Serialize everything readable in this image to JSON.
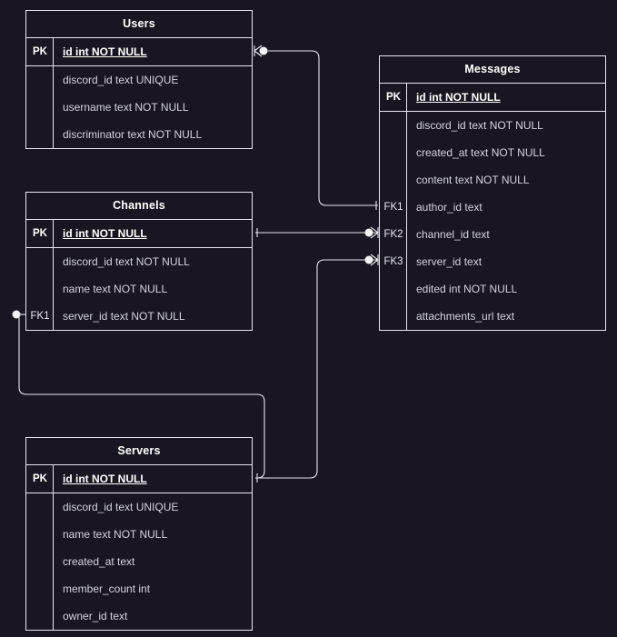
{
  "diagram": {
    "type": "entity-relationship-diagram",
    "notation": "crow's foot",
    "background_color": "#191622",
    "line_color": "#e8e8ef",
    "title_text_color": "#ffffff",
    "body_text_color": "#d4d4de"
  },
  "entities": [
    {
      "id": "users",
      "name": "Users",
      "attributes": [
        {
          "key": "PK",
          "name": "id int NOT NULL"
        },
        {
          "key": "",
          "name": "discord_id text UNIQUE"
        },
        {
          "key": "",
          "name": "username text NOT NULL"
        },
        {
          "key": "",
          "name": "discriminator text NOT NULL"
        }
      ]
    },
    {
      "id": "messages",
      "name": "Messages",
      "attributes": [
        {
          "key": "PK",
          "name": "id int NOT NULL"
        },
        {
          "key": "",
          "name": "discord_id text NOT NULL"
        },
        {
          "key": "",
          "name": "created_at text NOT NULL"
        },
        {
          "key": "",
          "name": "content text NOT NULL"
        },
        {
          "key": "FK1",
          "name": "author_id text"
        },
        {
          "key": "FK2",
          "name": "channel_id text"
        },
        {
          "key": "FK3",
          "name": "server_id text"
        },
        {
          "key": "",
          "name": "edited int NOT NULL"
        },
        {
          "key": "",
          "name": "attachments_url text"
        }
      ]
    },
    {
      "id": "channels",
      "name": "Channels",
      "attributes": [
        {
          "key": "PK",
          "name": "id int NOT NULL"
        },
        {
          "key": "",
          "name": "discord_id text NOT NULL"
        },
        {
          "key": "",
          "name": "name text NOT NULL"
        },
        {
          "key": "FK1",
          "name": "server_id text NOT NULL"
        }
      ]
    },
    {
      "id": "servers",
      "name": "Servers",
      "attributes": [
        {
          "key": "PK",
          "name": "id int NOT NULL"
        },
        {
          "key": "",
          "name": "discord_id text UNIQUE"
        },
        {
          "key": "",
          "name": "name text NOT NULL"
        },
        {
          "key": "",
          "name": "created_at text"
        },
        {
          "key": "",
          "name": "member_count int"
        },
        {
          "key": "",
          "name": "owner_id text"
        }
      ]
    }
  ],
  "relationships": [
    {
      "id": "users-messages",
      "from_entity": "Users",
      "from_attribute": "id int NOT NULL",
      "from_cardinality": "zero-or-many",
      "to_entity": "Messages",
      "to_attribute": "author_id text",
      "to_cardinality": "one"
    },
    {
      "id": "channels-messages",
      "from_entity": "Channels",
      "from_attribute": "id int NOT NULL",
      "from_cardinality": "one",
      "to_entity": "Messages",
      "to_attribute": "channel_id text",
      "to_cardinality": "zero-or-many"
    },
    {
      "id": "servers-messages",
      "from_entity": "Servers",
      "from_attribute": "id int NOT NULL",
      "from_cardinality": "one",
      "to_entity": "Messages",
      "to_attribute": "server_id text",
      "to_cardinality": "zero-or-many"
    },
    {
      "id": "servers-channels",
      "from_entity": "Servers",
      "from_attribute": "id int NOT NULL",
      "from_cardinality": "one",
      "to_entity": "Channels",
      "to_attribute": "server_id text NOT NULL",
      "to_cardinality": "zero-or-many"
    }
  ]
}
